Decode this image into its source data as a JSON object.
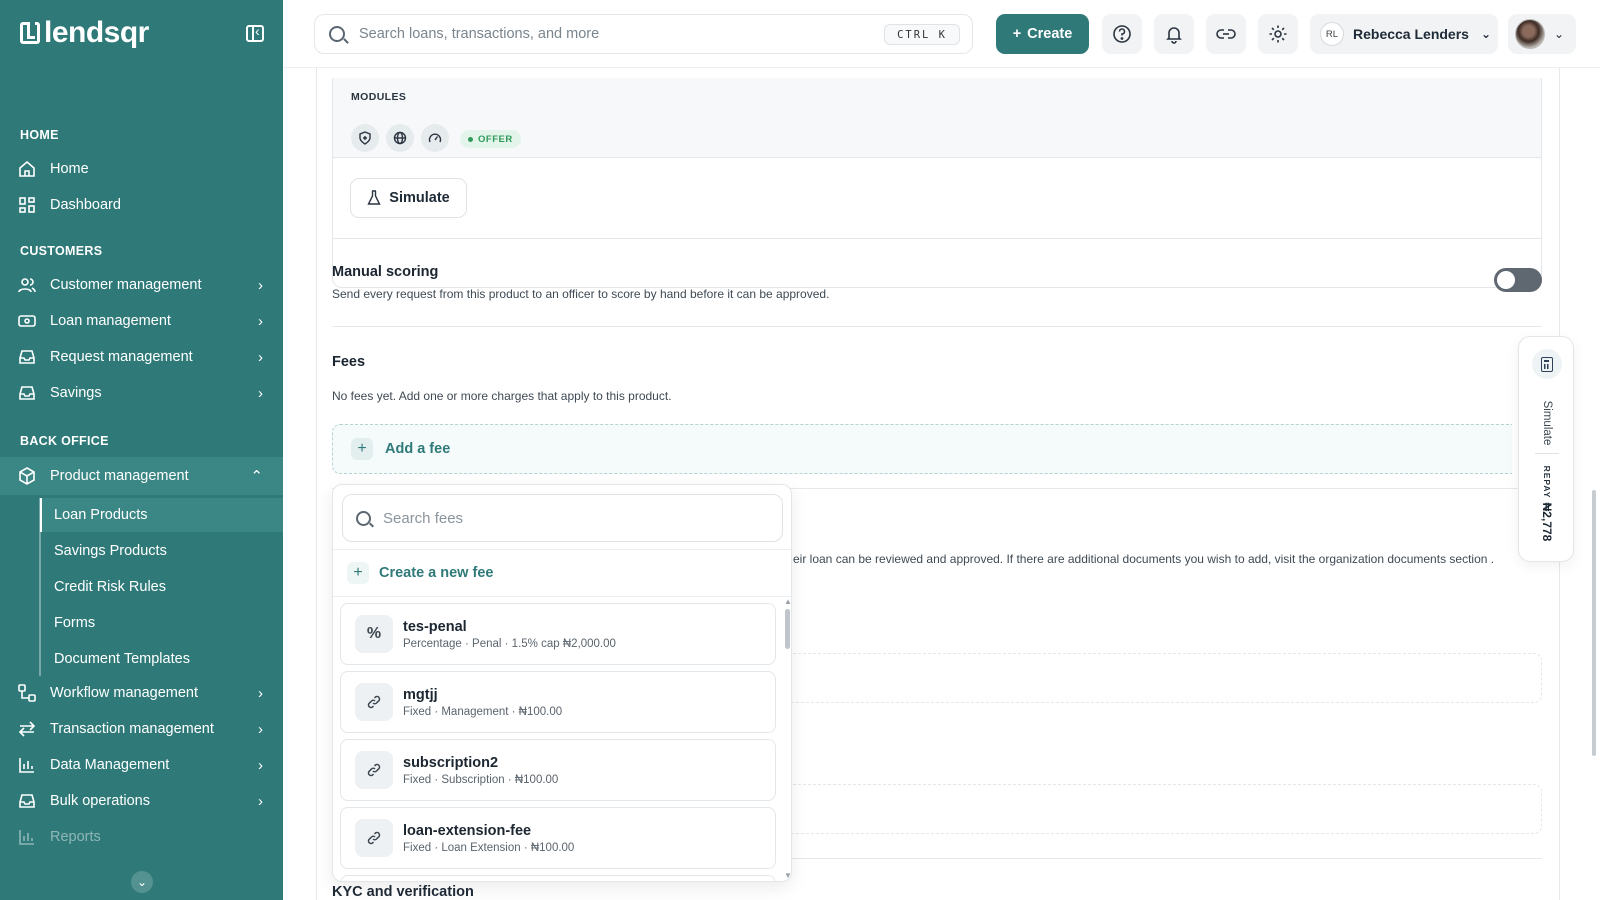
{
  "brand": {
    "name": "lendsqr",
    "accent": "#2f7a79"
  },
  "sidebar": {
    "sections": {
      "home": "HOME",
      "customers": "CUSTOMERS",
      "back_office": "BACK OFFICE"
    },
    "items": {
      "home": {
        "label": "Home",
        "icon": "home-icon"
      },
      "dashboard": {
        "label": "Dashboard",
        "icon": "grid-icon"
      },
      "customer_management": {
        "label": "Customer management",
        "icon": "users-icon"
      },
      "loan_management": {
        "label": "Loan management",
        "icon": "banknote-icon"
      },
      "request_management": {
        "label": "Request management",
        "icon": "inbox-icon"
      },
      "savings": {
        "label": "Savings",
        "icon": "piggy-bank-icon"
      },
      "product_management": {
        "label": "Product management",
        "icon": "box-icon"
      },
      "workflow_management": {
        "label": "Workflow management",
        "icon": "workflow-icon"
      },
      "transaction_management": {
        "label": "Transaction management",
        "icon": "arrows-icon"
      },
      "data_management": {
        "label": "Data Management",
        "icon": "bar-chart-icon"
      },
      "bulk_operations": {
        "label": "Bulk operations",
        "icon": "inbox-icon"
      },
      "reports": {
        "label": "Reports",
        "icon": "bar-chart-icon"
      }
    },
    "product_sub_items": [
      "Loan Products",
      "Savings Products",
      "Credit Risk Rules",
      "Forms",
      "Document Templates"
    ]
  },
  "header": {
    "search_placeholder": "Search loans, transactions, and more",
    "shortcut": "CTRL K",
    "create_label": "Create",
    "user_initials": "RL",
    "user_name": "Rebecca Lenders"
  },
  "modules": {
    "label": "MODULES",
    "icons": [
      "shield-icon",
      "globe-icon",
      "gauge-icon"
    ],
    "badge": "OFFER",
    "simulate_label": "Simulate"
  },
  "manual_scoring": {
    "title": "Manual scoring",
    "description": "Send every request from this product to an officer to score by hand before it can be approved.",
    "enabled": false
  },
  "fees": {
    "title": "Fees",
    "empty_text": "No fees yet. Add one or more charges that apply to this product.",
    "add_label": "Add a fee"
  },
  "documents_partial_text": "eir loan can be reviewed and approved. If there are additional documents you wish to add, visit the organization documents section .",
  "kyc_title": "KYC and verification",
  "fee_dropdown": {
    "search_placeholder": "Search fees",
    "create_label": "Create a new fee",
    "items": [
      {
        "name": "tes-penal",
        "meta": "Percentage · Penal · 1.5% cap ₦2,000.00",
        "icon": "percent-icon"
      },
      {
        "name": "mgtjj",
        "meta": "Fixed · Management · ₦100.00",
        "icon": "link-icon"
      },
      {
        "name": "subscription2",
        "meta": "Fixed · Subscription · ₦100.00",
        "icon": "link-icon"
      },
      {
        "name": "loan-extension-fee",
        "meta": "Fixed · Loan Extension · ₦100.00",
        "icon": "link-icon"
      }
    ]
  },
  "simulate_panel": {
    "label": "Simulate",
    "repay_label": "REPAY",
    "repay_value": "₦2,778"
  }
}
